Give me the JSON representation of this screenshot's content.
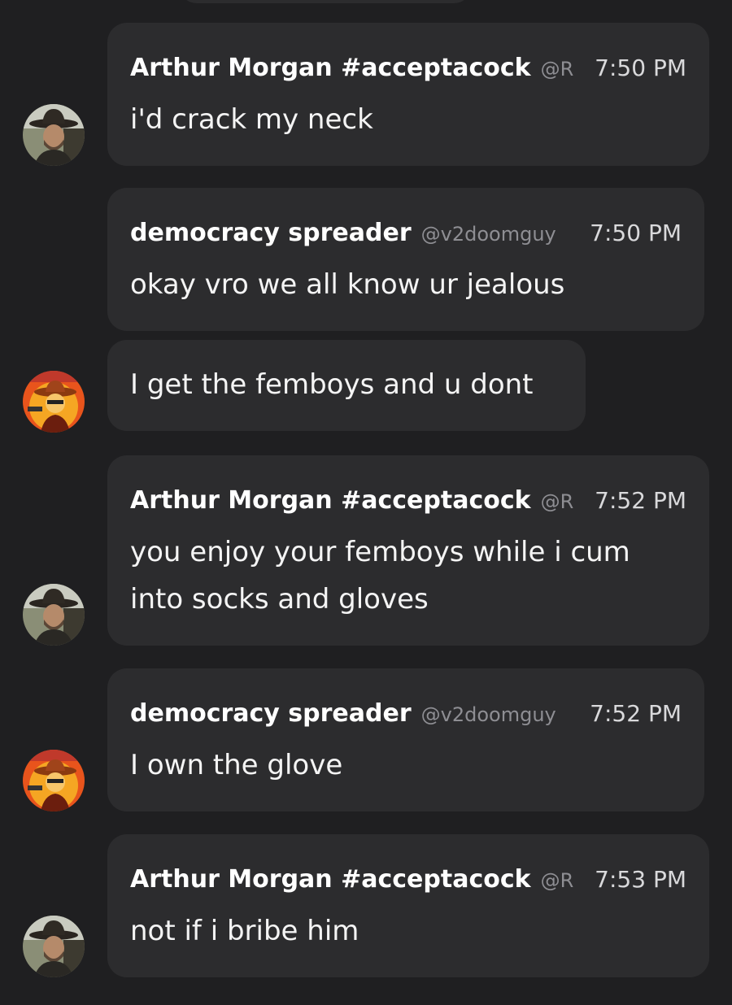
{
  "messages": [
    {
      "author": "Arthur Morgan #acceptacock",
      "handle": "@R",
      "time": "7:50 PM",
      "text": "i'd crack my neck"
    },
    {
      "author": "democracy spreader",
      "handle": "@v2doomguy",
      "time": "7:50 PM",
      "text": "okay vro we all know ur jealous"
    },
    {
      "text": "I get the femboys and u dont"
    },
    {
      "author": "Arthur Morgan #acceptacock",
      "handle": "@R",
      "time": "7:52 PM",
      "text": "you enjoy your femboys while i cum into socks and gloves"
    },
    {
      "author": "democracy spreader",
      "handle": "@v2doomguy",
      "time": "7:52 PM",
      "text": "I own the glove"
    },
    {
      "author": "Arthur Morgan #acceptacock",
      "handle": "@R",
      "time": "7:53 PM",
      "text": "not if i bribe him"
    }
  ],
  "avatars": {
    "arthur": {
      "icon": "cowboy-hat-man-avatar",
      "bg": "#6b6f5a"
    },
    "democracy": {
      "icon": "cartoon-cowboy-logo-avatar",
      "bg": "#e8541c"
    }
  },
  "colors": {
    "background": "#1f1f21",
    "bubble": "#2c2c2e",
    "text": "#f4f4f4",
    "handle": "#8e8e93"
  }
}
